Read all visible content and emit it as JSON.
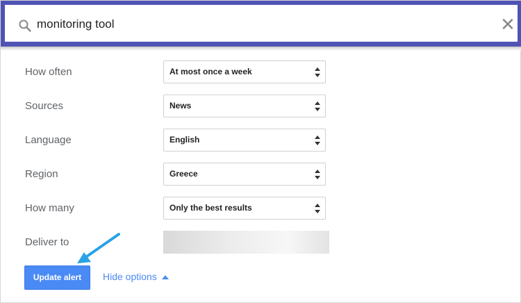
{
  "search": {
    "query": "monitoring tool"
  },
  "options": [
    {
      "label": "How often",
      "value": "At most once a week"
    },
    {
      "label": "Sources",
      "value": "News"
    },
    {
      "label": "Language",
      "value": "English"
    },
    {
      "label": "Region",
      "value": "Greece"
    },
    {
      "label": "How many",
      "value": "Only the best results"
    }
  ],
  "deliver_to": {
    "label": "Deliver to"
  },
  "actions": {
    "update_label": "Update alert",
    "hide_options_label": "Hide options"
  },
  "colors": {
    "header": "#4f53b4",
    "accent": "#4a8af4",
    "annotation_arrow": "#29a3e6"
  },
  "icons": [
    "search-icon",
    "close-icon",
    "select-arrows-icon",
    "caret-up-icon",
    "pointer-arrow"
  ]
}
